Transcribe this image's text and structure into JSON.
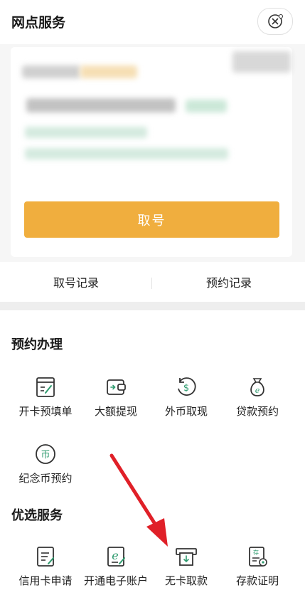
{
  "header": {
    "title": "网点服务"
  },
  "card": {
    "take_number_label": "取号"
  },
  "records": {
    "take_number_record": "取号记录",
    "appointment_record": "预约记录"
  },
  "sections": [
    {
      "title": "预约办理",
      "items": [
        {
          "label": "开卡预填单",
          "icon": "form-fill-icon"
        },
        {
          "label": "大额提现",
          "icon": "wallet-withdraw-icon"
        },
        {
          "label": "外币取现",
          "icon": "currency-exchange-icon"
        },
        {
          "label": "贷款预约",
          "icon": "money-bag-icon"
        },
        {
          "label": "纪念币预约",
          "icon": "coin-icon"
        }
      ]
    },
    {
      "title": "优选服务",
      "items": [
        {
          "label": "信用卡申请",
          "icon": "document-edit-icon"
        },
        {
          "label": "开通电子账户",
          "icon": "e-account-icon"
        },
        {
          "label": "无卡取款",
          "icon": "atm-cardless-icon"
        },
        {
          "label": "存款证明",
          "icon": "deposit-certificate-icon"
        }
      ]
    }
  ],
  "colors": {
    "accent": "#f0ae3e",
    "icon_green": "#2f9b6f",
    "arrow": "#e02028"
  }
}
